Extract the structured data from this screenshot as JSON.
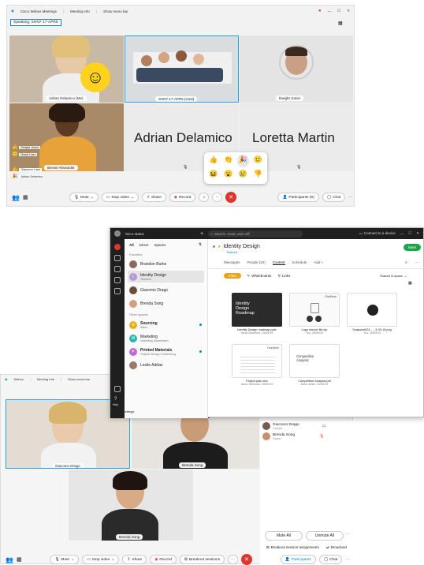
{
  "top_window": {
    "title_bar": {
      "app": "Cisco Webex Meetings",
      "meeting_info": "Meeting Info",
      "show_menu_bar": "Show menu bar"
    },
    "speaking": "Speaking: SHN7-17-APR5",
    "tiles": [
      {
        "name": "Adrian Delamico (Me)"
      },
      {
        "name": "SHN7-17-APR5 (Host)"
      },
      {
        "name": "Dwight Jones"
      },
      {
        "name": "Bessie Alexander"
      },
      {
        "name": "Adrian Delamico"
      },
      {
        "name": "Loretta Martin"
      }
    ],
    "reaction_list": [
      "Dwight Jones",
      "David Liam",
      "Giacomo Liam",
      "Adrian Delamico"
    ],
    "controls": {
      "mute": "Mute",
      "stop_video": "Stop video",
      "share": "Share",
      "record": "Record",
      "participants": "Participants (6)",
      "chat": "Chat"
    },
    "reactions": [
      "👍",
      "👏",
      "🎉",
      "🙂",
      "😆",
      "😮",
      "😢",
      "👎"
    ]
  },
  "teams_window": {
    "status": "Set a status",
    "search_placeholder": "Search, meet, and call",
    "connect_device": "Connect to a device",
    "filters": [
      "All",
      "Direct",
      "Spaces"
    ],
    "favorites_header": "Favorites",
    "other_header": "Other spaces",
    "spaces": [
      {
        "name": "Brandon Burke",
        "sub": ""
      },
      {
        "name": "Identity Design",
        "sub": "Teamers"
      },
      {
        "name": "Giacomo Drago",
        "sub": ""
      },
      {
        "name": "Brenda Song",
        "sub": ""
      },
      {
        "name": "Sourcing",
        "sub": "Sales"
      },
      {
        "name": "Marketing",
        "sub": "Marketing Department"
      },
      {
        "name": "Printed Materials",
        "sub": "Graphic Design & Marketing"
      },
      {
        "name": "Leslie Addas",
        "sub": ""
      }
    ],
    "help": "Help",
    "call_settings": "Call settings",
    "space_title": "Identity Design",
    "space_sub": "Teamers",
    "meet_button": "Meet",
    "tabs": [
      "Messages",
      "People (10)",
      "Content",
      "Schedule",
      "Add +"
    ],
    "subtabs": [
      "Files",
      "Whiteboards",
      "Links"
    ],
    "shared_in_space": "Shared in space",
    "files": [
      {
        "name": "Identity Design roadmap.pptx",
        "meta": "Anna Simmons, 24/09/19",
        "thumb_title": "Identity Design Roadmap"
      },
      {
        "name": "Logo source file.zip",
        "meta": "You, 28/09/19",
        "thumb_title": "OneDrive"
      },
      {
        "name": "Snapshot001 - ...3-09-18.png",
        "meta": "You, 18/09/19",
        "thumb_title": ""
      },
      {
        "name": "Project plan.xlsx",
        "meta": "Anna Simmons, 26/09/19",
        "thumb_title": "OneDrive"
      },
      {
        "name": "Competitive Analysis.pdf",
        "meta": "Mark Jones, 20/09/19",
        "thumb_title": "Competitive Analysis"
      }
    ]
  },
  "bottom_window": {
    "title_bar": {
      "app": "Webex",
      "meeting_info": "Meeting Info",
      "show_menu_bar": "Show menu bar"
    },
    "tiles": [
      {
        "name": "Giacomo Drago"
      },
      {
        "name": "Brenda Song"
      },
      {
        "name": "Brenda Song"
      }
    ],
    "participants": [
      {
        "name": "Giacomo Drago",
        "sub": "Cohost"
      },
      {
        "name": "Brenda Song",
        "sub": "Guest"
      }
    ],
    "mute_all": "Mute All",
    "unmute_all": "Unmute All",
    "breakout_assignments": "Breakout session assignments",
    "broadcast": "Broadcast",
    "controls": {
      "mute": "Mute",
      "stop_video": "Stop video",
      "share": "Share",
      "record": "Record",
      "breakout": "Breakout sessions",
      "participants": "Participants",
      "chat": "Chat"
    }
  },
  "colors": {
    "accent": "#0b84d8",
    "end": "#e0342f",
    "meet": "#1aa64a"
  }
}
